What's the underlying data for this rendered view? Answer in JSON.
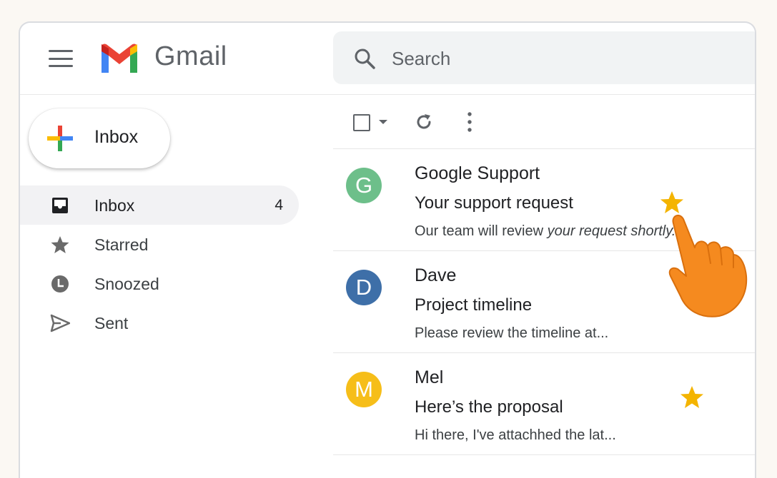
{
  "app": {
    "title": "Gmail"
  },
  "search": {
    "placeholder": "Search"
  },
  "compose": {
    "label": "Inbox"
  },
  "nav": {
    "items": [
      {
        "label": "Inbox",
        "count": "4",
        "icon": "inbox-icon",
        "active": true
      },
      {
        "label": "Starred",
        "icon": "star-icon"
      },
      {
        "label": "Snoozed",
        "icon": "clock-icon"
      },
      {
        "label": "Sent",
        "icon": "send-icon"
      }
    ]
  },
  "emails": [
    {
      "avatar": "G",
      "avatar_color": "#6dbf8a",
      "sender": "Google Support",
      "subject": "Your support request",
      "snippet_a": "Our team will review ",
      "snippet_b": "your request shortly..",
      "starred": true
    },
    {
      "avatar": "D",
      "avatar_color": "#3e6fa8",
      "sender": "Dave",
      "subject": "Project timeline",
      "snippet": "Please review the  timeline at...",
      "starred": false
    },
    {
      "avatar": "M",
      "avatar_color": "#f6be19",
      "sender": "Mel",
      "subject": "Here’s the proposal",
      "snippet": "Hi there, I've attachhed the lat...",
      "starred": true
    }
  ],
  "colors": {
    "star": "#f4b400",
    "hand": "#f58a1f",
    "gmail_red": "#ea4335",
    "gmail_blue": "#4285f4",
    "gmail_green": "#34a853",
    "gmail_yellow": "#fbbc04"
  }
}
